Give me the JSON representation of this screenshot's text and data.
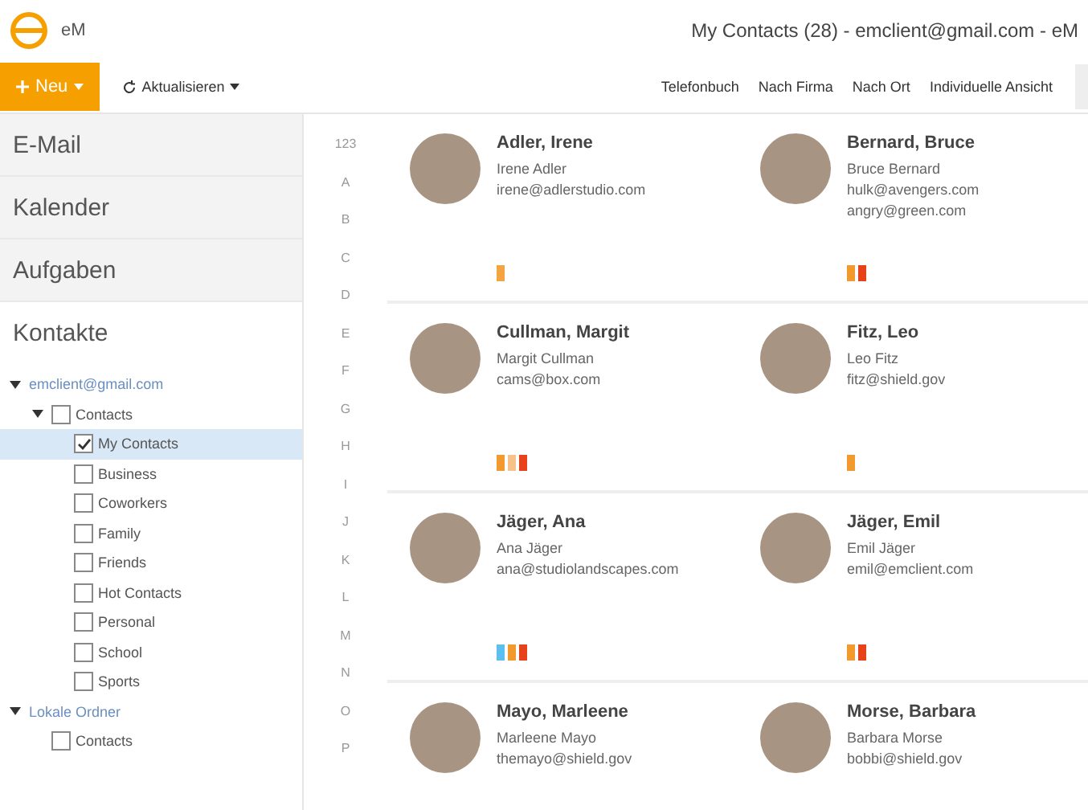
{
  "app": {
    "name": "eM"
  },
  "window": {
    "title": "My Contacts (28) - emclient@gmail.com - eM"
  },
  "toolbar": {
    "new_button": "Neu",
    "refresh_button": "Aktualisieren",
    "views": [
      "Telefonbuch",
      "Nach Firma",
      "Nach Ort",
      "Individuelle Ansicht"
    ]
  },
  "sidebar": {
    "nav": [
      {
        "label": "E-Mail",
        "selected": false
      },
      {
        "label": "Kalender",
        "selected": false
      },
      {
        "label": "Aufgaben",
        "selected": false
      },
      {
        "label": "Kontakte",
        "selected": true
      }
    ],
    "tree": [
      {
        "label": "emclient@gmail.com",
        "expanded": true,
        "children": [
          {
            "label": "Contacts",
            "expanded": true,
            "checked": false,
            "selected": false,
            "children": [
              {
                "label": "My Contacts",
                "checked": true,
                "selected": true
              },
              {
                "label": "Business",
                "checked": false,
                "selected": false
              },
              {
                "label": "Coworkers",
                "checked": false,
                "selected": false
              },
              {
                "label": "Family",
                "checked": false,
                "selected": false
              },
              {
                "label": "Friends",
                "checked": false,
                "selected": false
              },
              {
                "label": "Hot Contacts",
                "checked": false,
                "selected": false
              },
              {
                "label": "Personal",
                "checked": false,
                "selected": false
              },
              {
                "label": "School",
                "checked": false,
                "selected": false
              },
              {
                "label": "Sports",
                "checked": false,
                "selected": false
              }
            ]
          }
        ]
      },
      {
        "label": "Lokale Ordner",
        "expanded": true,
        "children": [
          {
            "label": "Contacts",
            "checked": false,
            "selected": false
          }
        ]
      }
    ]
  },
  "index": [
    "123",
    "A",
    "B",
    "C",
    "D",
    "E",
    "F",
    "G",
    "H",
    "I",
    "J",
    "K",
    "L",
    "M",
    "N",
    "O",
    "P"
  ],
  "contacts": [
    {
      "name": "Adler, Irene",
      "full_name": "Irene Adler",
      "emails": [
        "irene@adlerstudio.com"
      ],
      "tags": [
        {
          "color": "#f5a442"
        }
      ]
    },
    {
      "name": "Bernard, Bruce",
      "full_name": "Bruce Bernard",
      "emails": [
        "hulk@avengers.com",
        "angry@green.com"
      ],
      "tags": [
        {
          "color": "#f29a2e"
        },
        {
          "color": "#e8421a"
        }
      ]
    },
    {
      "name": "Cullman, Margit",
      "full_name": "Margit Cullman",
      "emails": [
        "cams@box.com"
      ],
      "tags": [
        {
          "color": "#f29a2e"
        },
        {
          "color": "#f7c28a"
        },
        {
          "color": "#e8421a"
        }
      ]
    },
    {
      "name": "Fitz, Leo",
      "full_name": "Leo Fitz",
      "emails": [
        "fitz@shield.gov"
      ],
      "tags": [
        {
          "color": "#f29a2e"
        }
      ]
    },
    {
      "name": "Jäger, Ana",
      "full_name": "Ana Jäger",
      "emails": [
        "ana@studiolandscapes.com"
      ],
      "tags": [
        {
          "color": "#5bc0f0"
        },
        {
          "color": "#f29a2e"
        },
        {
          "color": "#e8421a"
        }
      ]
    },
    {
      "name": "Jäger, Emil",
      "full_name": "Emil Jäger",
      "emails": [
        "emil@emclient.com"
      ],
      "tags": [
        {
          "color": "#f29a2e"
        },
        {
          "color": "#e8421a"
        }
      ]
    },
    {
      "name": "Mayo, Marleene",
      "full_name": "Marleene Mayo",
      "emails": [
        "themayo@shield.gov"
      ]
    },
    {
      "name": "Morse, Barbara",
      "full_name": "Barbara Morse",
      "emails": [
        "bobbi@shield.gov"
      ]
    }
  ]
}
